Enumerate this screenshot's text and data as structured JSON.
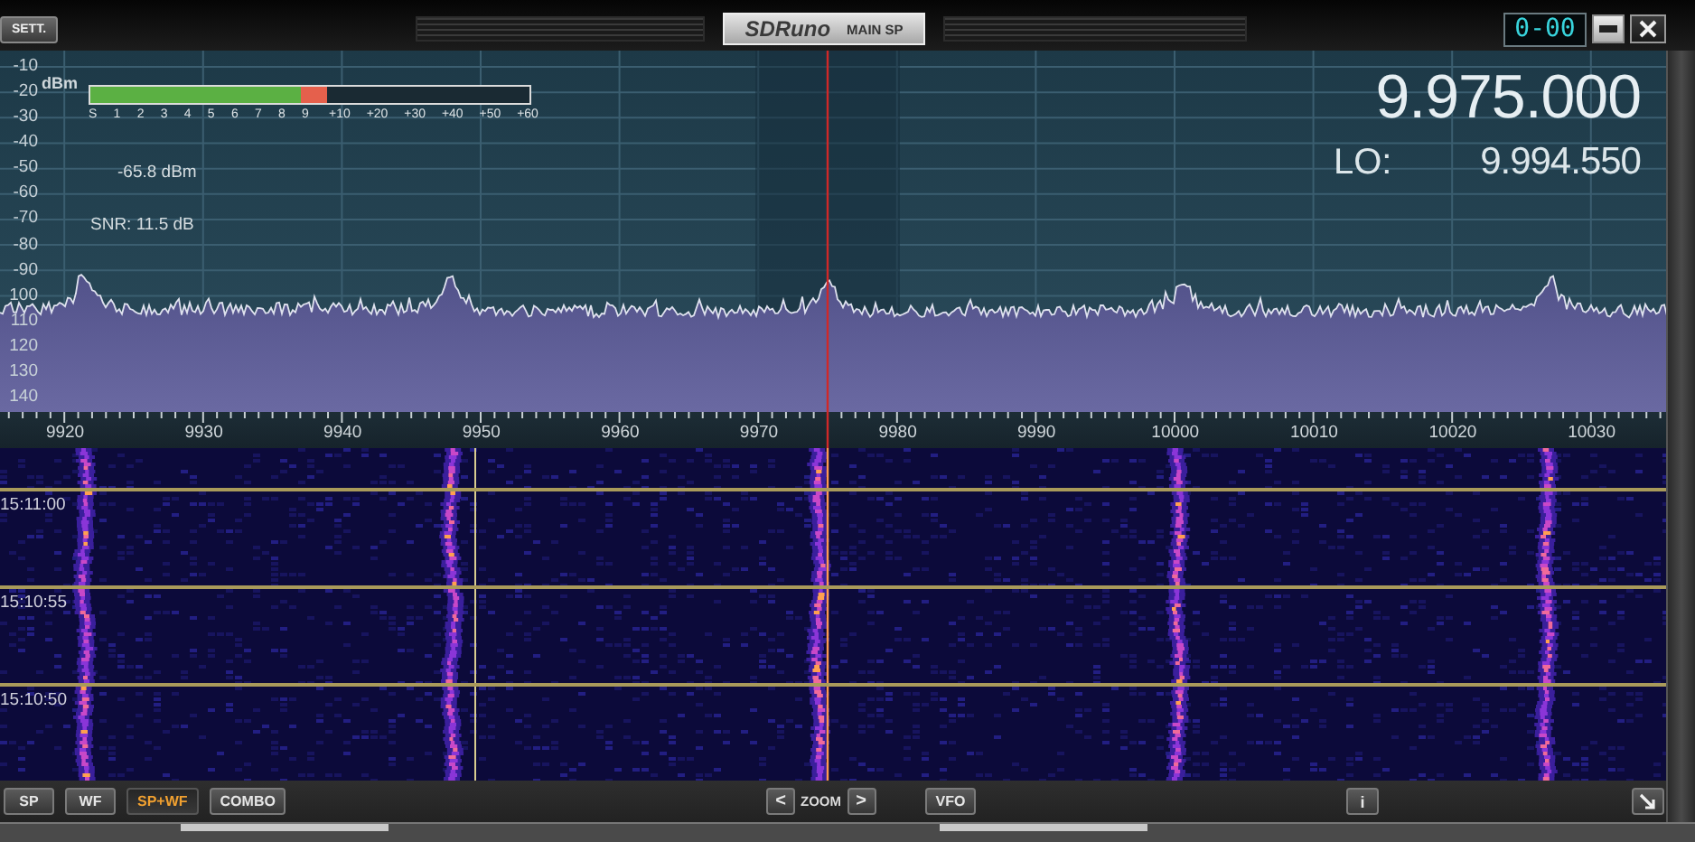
{
  "title_bar": {
    "settings_button": "SETT.",
    "logo": "SDRuno",
    "window_title": "MAIN SP",
    "channel_display": "0-00"
  },
  "spectrum": {
    "unit": "dBm",
    "db_scale": [
      "-10",
      "-20",
      "-30",
      "-40",
      "-50",
      "-60",
      "-70",
      "-80",
      "-90",
      "100",
      "110",
      "120",
      "130",
      "140"
    ],
    "s_meter": {
      "level": 0.54,
      "scale": [
        "S",
        "1",
        "2",
        "3",
        "4",
        "5",
        "6",
        "7",
        "8",
        "9",
        "+10",
        "+20",
        "+30",
        "+40",
        "+50",
        "+60"
      ]
    },
    "signal_reading": "-65.8 dBm",
    "snr_reading": "SNR: 11.5 dB",
    "frequency": "9.975.000",
    "lo_label": "LO:",
    "lo_frequency": "9.994.550"
  },
  "frequency_scale": [
    "9920",
    "9930",
    "9940",
    "9950",
    "9960",
    "9970",
    "9980",
    "9990",
    "10000",
    "10010",
    "10020",
    "10030"
  ],
  "waterfall": {
    "time_marks": [
      "15:11:00",
      "15:10:55",
      "15:10:50"
    ]
  },
  "bottom_bar": {
    "view_modes": [
      {
        "label": "SP",
        "selected": false
      },
      {
        "label": "WF",
        "selected": false
      },
      {
        "label": "SP+WF",
        "selected": true
      },
      {
        "label": "COMBO",
        "selected": false
      }
    ],
    "zoom_out": "<",
    "zoom_label": "ZOOM",
    "zoom_in": ">",
    "vfo_button": "VFO",
    "info_button": "i"
  }
}
